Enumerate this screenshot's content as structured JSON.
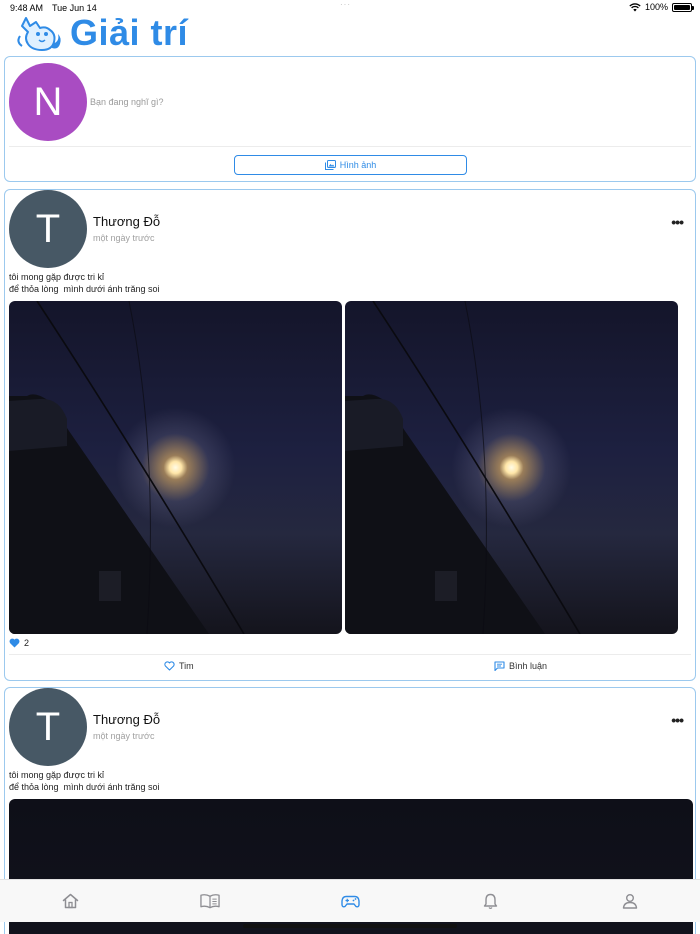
{
  "status_bar": {
    "time": "9:48 AM",
    "date": "Tue Jun 14",
    "battery": "100%",
    "battery_level": 1.0
  },
  "header": {
    "title": "Giải trí",
    "logo_icon": "cat-logo-icon"
  },
  "composer": {
    "avatar_letter": "N",
    "avatar_color": "#a94cc2",
    "placeholder": "Bạn đang nghĩ gì?",
    "image_button_label": "Hình ảnh"
  },
  "posts": [
    {
      "avatar_letter": "T",
      "avatar_color": "#475865",
      "author": "Thương Đỗ",
      "time_ago": "một ngày trước",
      "caption": "tôi mong gặp được tri kỉ\nđể thỏa lòng  mình dưới ánh trăng soi",
      "like_count": "2",
      "like_label": "Tim",
      "comment_label": "Bình luận"
    },
    {
      "avatar_letter": "T",
      "avatar_color": "#475865",
      "author": "Thương Đỗ",
      "time_ago": "một ngày trước",
      "caption": "tôi mong gặp được tri kỉ\nđể thỏa lòng  mình dưới ánh trăng soi"
    }
  ],
  "tab_bar": {
    "tabs": [
      {
        "icon": "home-icon",
        "active": false
      },
      {
        "icon": "book-icon",
        "active": false
      },
      {
        "icon": "gamepad-icon",
        "active": true
      },
      {
        "icon": "bell-icon",
        "active": false
      },
      {
        "icon": "user-icon",
        "active": false
      }
    ],
    "active_color": "#2f8be6",
    "inactive_color": "#8e8e93"
  },
  "colors": {
    "accent": "#2f8be6",
    "card_border": "#9cc9ee"
  }
}
